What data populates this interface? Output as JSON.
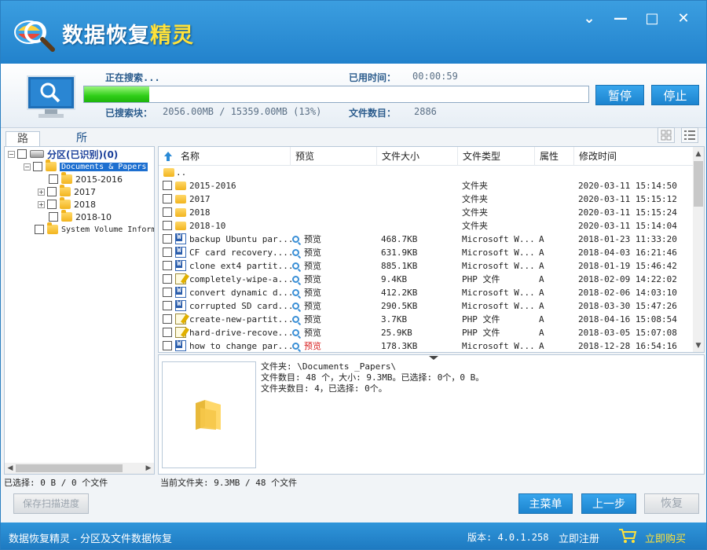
{
  "app": {
    "title_part1": "数据恢复",
    "title_part2": "精灵"
  },
  "window_controls": {
    "dropdown": "⌄",
    "minimize": "—",
    "maximize": "□",
    "close": "✕"
  },
  "search": {
    "status": "正在搜索...",
    "elapsed_label": "已用时间：",
    "elapsed_value": "00:00:59",
    "searched_label": "已搜索块：",
    "searched_value": "2056.00MB / 15359.00MB (13%)",
    "files_label": "文件数目：",
    "files_value": "2886",
    "progress_percent": 13,
    "pause_label": "暂停",
    "stop_label": "停止"
  },
  "tabs": {
    "path": "路径",
    "all_types": "所有类型"
  },
  "tree": {
    "root": "分区(已识别)(0)",
    "selected": "Documents & Papers",
    "children": [
      "2015-2016",
      "2017",
      "2018",
      "2018-10"
    ],
    "other": "System Volume Information"
  },
  "list": {
    "headers": {
      "name": "名称",
      "preview": "预览",
      "size": "文件大小",
      "type": "文件类型",
      "attr": "属性",
      "mtime": "修改时间"
    },
    "parent": "..",
    "rows": [
      {
        "icon": "folder",
        "name": "2015-2016",
        "preview": "",
        "size": "",
        "type": "文件夹",
        "attr": "",
        "mtime": "2020-03-11 15:14:50"
      },
      {
        "icon": "folder",
        "name": "2017",
        "preview": "",
        "size": "",
        "type": "文件夹",
        "attr": "",
        "mtime": "2020-03-11 15:15:12"
      },
      {
        "icon": "folder",
        "name": "2018",
        "preview": "",
        "size": "",
        "type": "文件夹",
        "attr": "",
        "mtime": "2020-03-11 15:15:24"
      },
      {
        "icon": "folder",
        "name": "2018-10",
        "preview": "",
        "size": "",
        "type": "文件夹",
        "attr": "",
        "mtime": "2020-03-11 15:14:04"
      },
      {
        "icon": "word",
        "name": "backup Ubuntu par...",
        "preview": "预览",
        "size": "468.7KB",
        "type": "Microsoft W...",
        "attr": "A",
        "mtime": "2018-01-23 11:33:20"
      },
      {
        "icon": "word",
        "name": "CF card recovery....",
        "preview": "预览",
        "size": "631.9KB",
        "type": "Microsoft W...",
        "attr": "A",
        "mtime": "2018-04-03 16:21:46"
      },
      {
        "icon": "word",
        "name": "clone ext4 partit...",
        "preview": "预览",
        "size": "885.1KB",
        "type": "Microsoft W...",
        "attr": "A",
        "mtime": "2018-01-19 15:46:42"
      },
      {
        "icon": "php",
        "name": "completely-wipe-a...",
        "preview": "预览",
        "size": "9.4KB",
        "type": "PHP 文件",
        "attr": "A",
        "mtime": "2018-02-09 14:22:02"
      },
      {
        "icon": "word",
        "name": "convert dynamic d...",
        "preview": "预览",
        "size": "412.2KB",
        "type": "Microsoft W...",
        "attr": "A",
        "mtime": "2018-02-06 14:03:10"
      },
      {
        "icon": "word",
        "name": "corrupted SD card...",
        "preview": "预览",
        "size": "290.5KB",
        "type": "Microsoft W...",
        "attr": "A",
        "mtime": "2018-03-30 15:47:26"
      },
      {
        "icon": "php",
        "name": "create-new-partit...",
        "preview": "预览",
        "size": "3.7KB",
        "type": "PHP 文件",
        "attr": "A",
        "mtime": "2018-04-16 15:08:54"
      },
      {
        "icon": "php",
        "name": "hard-drive-recove...",
        "preview": "预览",
        "size": "25.9KB",
        "type": "PHP 文件",
        "attr": "A",
        "mtime": "2018-03-05 15:07:08"
      },
      {
        "icon": "word",
        "name": "how to change par...",
        "preview": "预览",
        "size": "178.3KB",
        "type": "Microsoft W...",
        "attr": "A",
        "mtime": "2018-12-28 16:54:16"
      }
    ]
  },
  "preview": {
    "folder_line": "文件夹: \\Documents _Papers\\",
    "count_line": "文件数目: 48 个，大小: 9.3MB。已选择: 0个，0 B。",
    "subfolder_line": "文件夹数目: 4，已选择: 0个。"
  },
  "status": {
    "left": "已选择: 0 B / 0 个文件",
    "right": "当前文件夹: 9.3MB / 48 个文件"
  },
  "buttons": {
    "save_progress": "保存扫描进度",
    "main_menu": "主菜单",
    "prev": "上一步",
    "recover": "恢复"
  },
  "footer": {
    "app_desc": "数据恢复精灵 - 分区及文件数据恢复",
    "version": "版本: 4.0.1.258",
    "register": "立即注册",
    "buy": "立即购买"
  },
  "colors": {
    "titlebar": "#2282cc",
    "progress": "#2fce18",
    "accent_button": "#1c84cf",
    "preview_highlight": "#d82020"
  }
}
